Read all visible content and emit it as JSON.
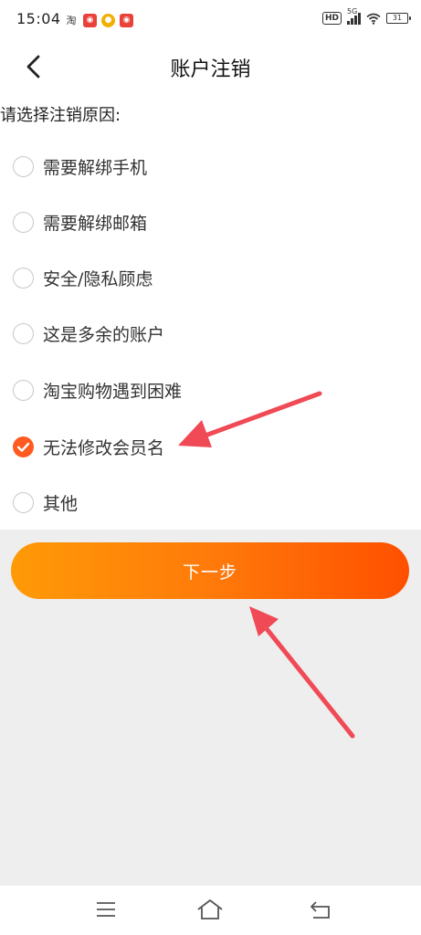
{
  "status_bar": {
    "time": "15:04",
    "taobao_label": "淘",
    "hd_label": "HD",
    "network_label": "5G",
    "battery_level": "31"
  },
  "header": {
    "back_icon": "chevron-left-icon",
    "title": "账户注销"
  },
  "prompt": "请选择注销原因:",
  "options": [
    {
      "label": "需要解绑手机",
      "checked": false
    },
    {
      "label": "需要解绑邮箱",
      "checked": false
    },
    {
      "label": "安全/隐私顾虑",
      "checked": false
    },
    {
      "label": "这是多余的账户",
      "checked": false
    },
    {
      "label": "淘宝购物遇到困难",
      "checked": false
    },
    {
      "label": "无法修改会员名",
      "checked": true
    },
    {
      "label": "其他",
      "checked": false
    }
  ],
  "next_button": {
    "label": "下一步"
  },
  "colors": {
    "accent": "#ff5a1f",
    "button_gradient_start": "#ff9a06",
    "button_gradient_end": "#ff5000",
    "annotation_arrow": "#ef4a55",
    "background_gray": "#eeeeee"
  },
  "system_nav": {
    "menu_icon": "menu-icon",
    "home_icon": "home-icon",
    "back_icon": "back-icon"
  }
}
